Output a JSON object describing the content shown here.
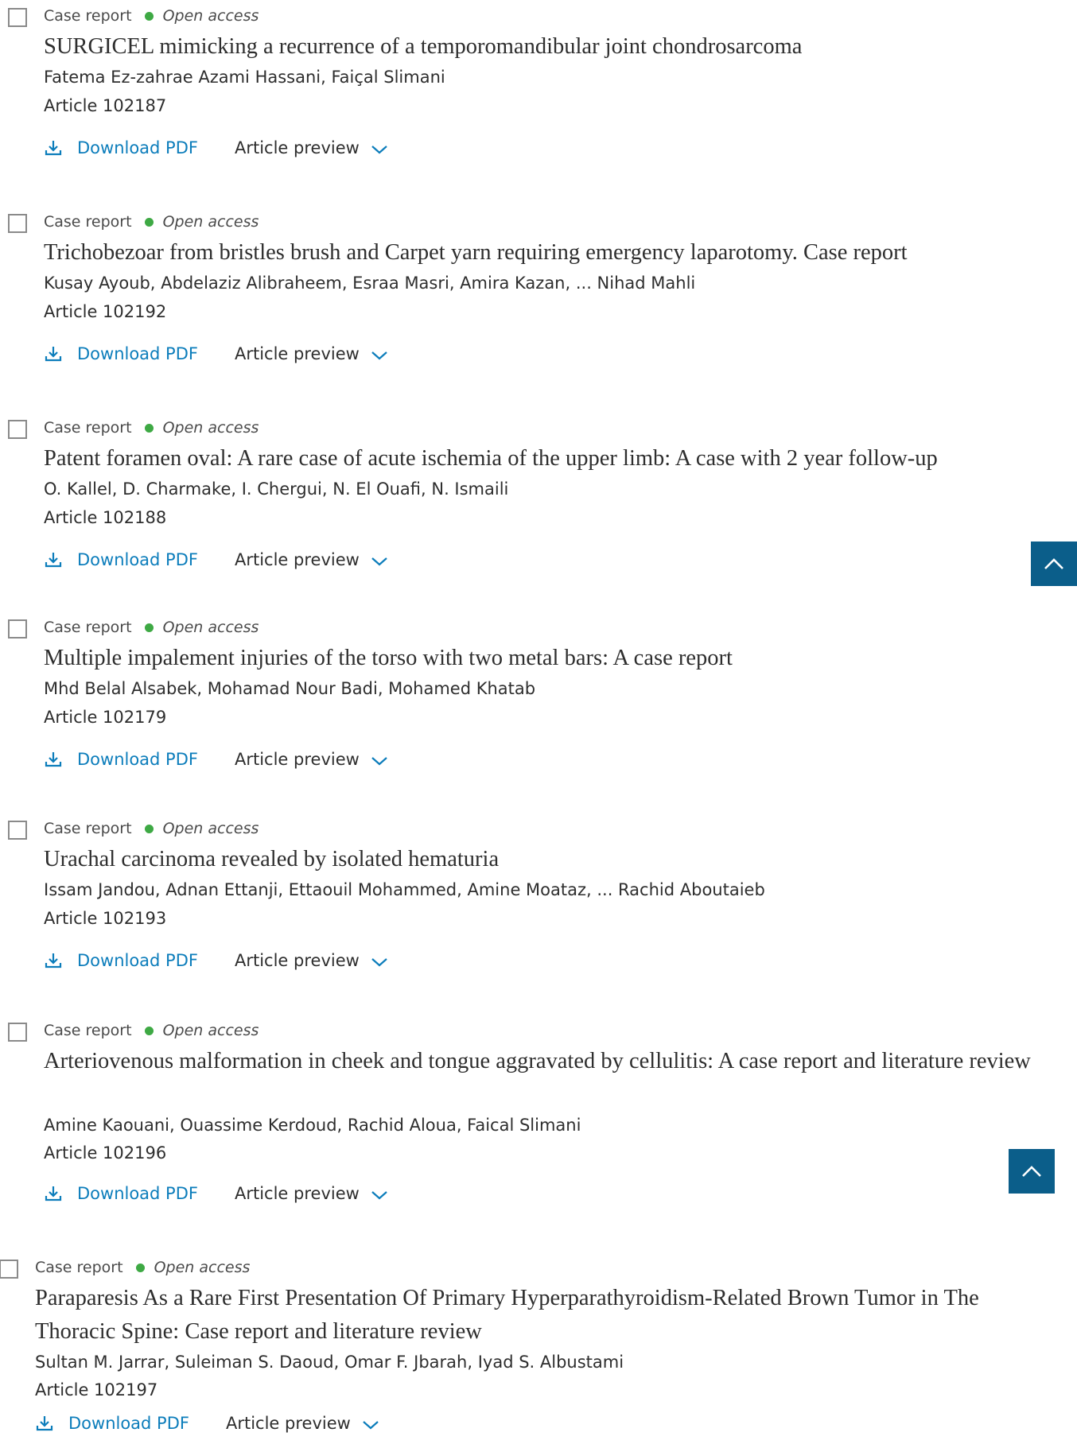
{
  "articles": [
    {
      "type": "Case report",
      "access": "Open access",
      "title": "SURGICEL mimicking a recurrence of a temporomandibular joint chondrosarcoma",
      "authors": "Fatema Ez-zahrae Azami Hassani, Faiçal Slimani",
      "article_number": "Article 102187",
      "download_label": "Download PDF",
      "preview_label": "Article preview"
    },
    {
      "type": "Case report",
      "access": "Open access",
      "title": "Trichobezoar from bristles brush and Carpet yarn requiring emergency laparotomy. Case report",
      "authors": "Kusay Ayoub, Abdelaziz Alibraheem, Esraa Masri, Amira Kazan, ... Nihad Mahli",
      "article_number": "Article 102192",
      "download_label": "Download PDF",
      "preview_label": "Article preview"
    },
    {
      "type": "Case report",
      "access": "Open access",
      "title": "Patent foramen oval: A rare case of acute ischemia of the upper limb: A case with 2 year follow-up",
      "authors": "O. Kallel, D. Charmake, I. Chergui, N. El Ouafi, N. Ismaili",
      "article_number": "Article 102188",
      "download_label": "Download PDF",
      "preview_label": "Article preview"
    },
    {
      "type": "Case report",
      "access": "Open access",
      "title": "Multiple impalement injuries of the torso with two metal bars: A case report",
      "authors": "Mhd Belal Alsabek, Mohamad Nour Badi, Mohamed Khatab",
      "article_number": "Article 102179",
      "download_label": "Download PDF",
      "preview_label": "Article preview"
    },
    {
      "type": "Case report",
      "access": "Open access",
      "title": "Urachal carcinoma revealed by isolated hematuria",
      "authors": "Issam Jandou, Adnan Ettanji, Ettaouil Mohammed, Amine Moataz, ... Rachid Aboutaieb",
      "article_number": "Article 102193",
      "download_label": "Download PDF",
      "preview_label": "Article preview"
    },
    {
      "type": "Case report",
      "access": "Open access",
      "title": "Arteriovenous malformation in cheek and tongue aggravated by cellulitis: A case report and literature review",
      "authors": "Amine Kaouani, Ouassime Kerdoud, Rachid Aloua, Faical Slimani",
      "article_number": "Article 102196",
      "download_label": "Download PDF",
      "preview_label": "Article preview"
    },
    {
      "type": "Case report",
      "access": "Open access",
      "title": "Paraparesis As a Rare First Presentation Of Primary Hyperparathyroidism-Related Brown Tumor in The Thoracic Spine: Case report and literature review",
      "authors": "Sultan M. Jarrar, Suleiman S. Daoud, Omar F. Jbarah, Iyad S. Albustami",
      "article_number": "Article 102197",
      "download_label": "Download PDF",
      "preview_label": "Article preview"
    }
  ],
  "colors": {
    "link": "#0c7dbb",
    "open_access_dot": "#3ea944",
    "back_to_top_bg": "#0b5e8a",
    "text": "#2e2e2e"
  },
  "icons": {
    "download": "download-icon",
    "preview_toggle": "chevron-down-icon",
    "back_to_top": "chevron-up-icon"
  }
}
